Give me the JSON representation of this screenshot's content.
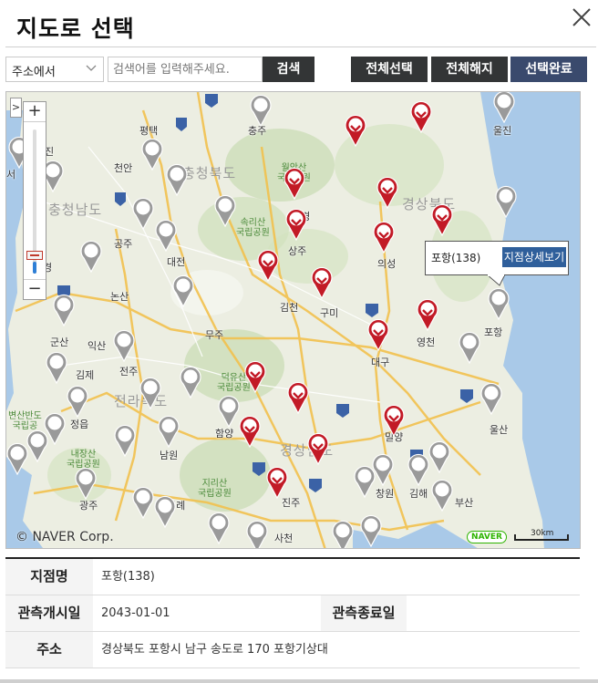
{
  "dialog": {
    "title": "지도로 선택",
    "close_icon": "close-icon"
  },
  "toolbar": {
    "search_scope": "주소에서",
    "search_placeholder": "검색어를 입력해주세요.",
    "search_button": "검색",
    "select_all": "전체선택",
    "deselect_all": "전체해지",
    "done": "선택완료"
  },
  "map": {
    "expand_label": ">",
    "zoom_in": "+",
    "zoom_out": "−",
    "zoom_level": 0.08,
    "regions": [
      "충청북도",
      "충청남도",
      "경상북도",
      "경상남도",
      "전라북도"
    ],
    "places": [
      "평택",
      "충주",
      "울진",
      "천안",
      "공주",
      "대전",
      "논산",
      "익산",
      "군산",
      "김제",
      "전주",
      "정읍",
      "남원",
      "광주",
      "구례",
      "함양",
      "진주",
      "사천",
      "창원",
      "김해",
      "부산",
      "울산",
      "밀양",
      "대구",
      "구미",
      "김천",
      "상주",
      "문경",
      "의성",
      "영천",
      "포항",
      "무주",
      "진",
      "서",
      "경"
    ],
    "parks": [
      "월악산\n국립공원",
      "속리산\n국립공원",
      "덕유산\n국립공원",
      "지리산\n국립공원",
      "내장산\n국립공원",
      "변산반도\n국립공"
    ],
    "popup": {
      "name": "포항(138)",
      "detail_button": "지점상세보기"
    },
    "copyright": "© NAVER Corp.",
    "logo": "NAVER",
    "scale": "30km",
    "colors": {
      "selected_marker": "#c21a26",
      "unselected_marker": "#9a9a9a",
      "popup_button": "#2f5f9b",
      "primary_button": "#3a4a6d"
    }
  },
  "station_info": {
    "name_label": "지점명",
    "name_value": "포항(138)",
    "start_label": "관측개시일",
    "start_value": "2043-01-01",
    "end_label": "관측종료일",
    "end_value": "",
    "address_label": "주소",
    "address_value": "경상북도 포항시 남구 송도로 170 포항기상대"
  }
}
